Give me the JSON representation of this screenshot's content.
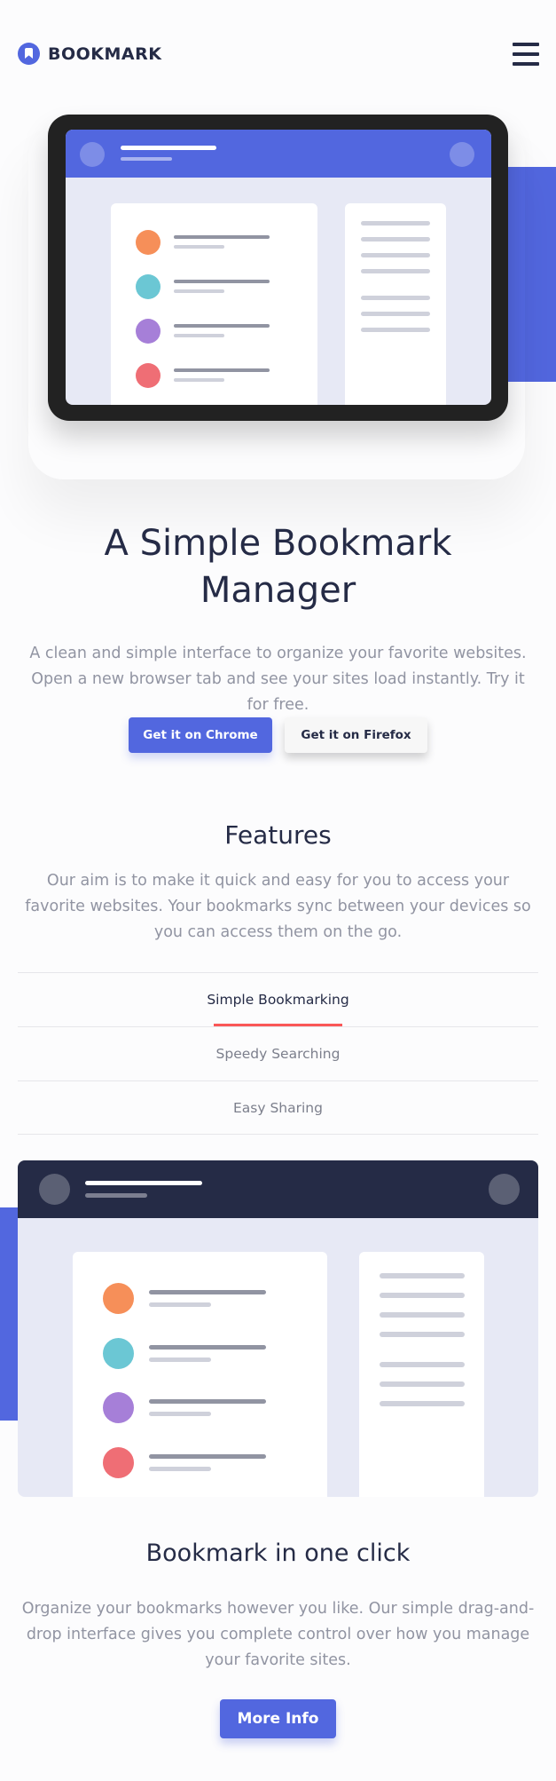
{
  "header": {
    "logo_text": "BOOKMARK",
    "menu_icon": "hamburger-icon"
  },
  "hero": {
    "title_line1": "A Simple Bookmark",
    "title_line2": "Manager",
    "description": "A clean and simple interface to organize your favorite websites. Open a new browser tab and see your sites load instantly. Try it for free.",
    "buttons": {
      "chrome": "Get it on Chrome",
      "firefox": "Get it on Firefox"
    }
  },
  "features": {
    "title": "Features",
    "description": "Our aim is to make it quick and easy for you to access your favorite websites. Your bookmarks sync between your devices so you can access them on the go.",
    "tabs": [
      {
        "label": "Simple Bookmarking",
        "active": true
      },
      {
        "label": "Speedy Searching",
        "active": false
      },
      {
        "label": "Easy Sharing",
        "active": false
      }
    ]
  },
  "feature_detail": {
    "title": "Bookmark in one click",
    "description": "Organize your bookmarks however you like. Our simple drag-and-drop interface gives you complete control over how you manage your favorite sites.",
    "button": "More Info"
  },
  "colors": {
    "accent": "#5267df",
    "danger": "#fa5757",
    "dark": "#252b46",
    "muted": "#9194a2",
    "bookmark_dots": [
      "#f68f59",
      "#6bc7d4",
      "#a67fd8",
      "#ef6e75"
    ]
  }
}
